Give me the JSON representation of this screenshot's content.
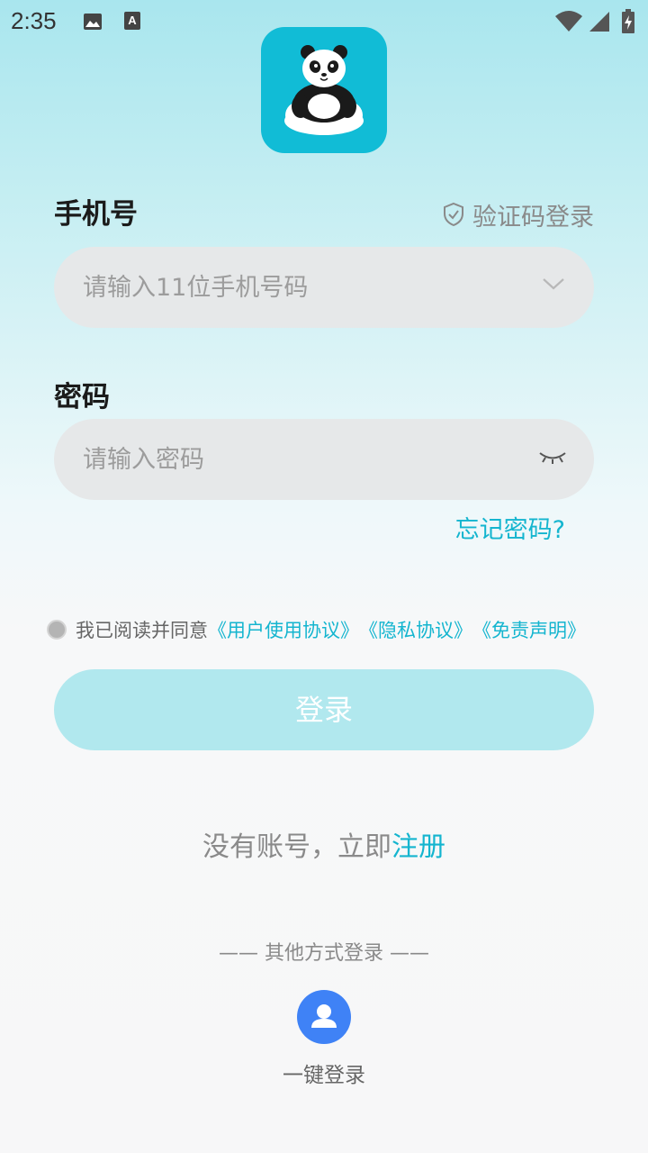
{
  "status_bar": {
    "time": "2:35",
    "icons": [
      "image-icon",
      "keyboard-a-icon",
      "wifi-icon",
      "signal-icon",
      "battery-icon"
    ]
  },
  "logo": {
    "icon": "panda-logo-icon",
    "bg_color": "#11bcd6"
  },
  "phone": {
    "label": "手机号",
    "placeholder": "请输入11位手机号码",
    "value": ""
  },
  "sms_login": {
    "label": "验证码登录",
    "icon": "shield-check-icon"
  },
  "password": {
    "label": "密码",
    "placeholder": "请输入密码",
    "value": ""
  },
  "forgot_password": "忘记密码?",
  "agreement": {
    "prefix": "我已阅读并同意",
    "user_agreement": "《用户使用协议》",
    "privacy": "《隐私协议》",
    "disclaimer": "《免责声明》",
    "checked": false
  },
  "login_button": "登录",
  "register": {
    "prefix": "没有账号，立即",
    "link": "注册"
  },
  "other_methods": {
    "title": "—— 其他方式登录 ——",
    "one_key_label": "一键登录"
  },
  "colors": {
    "accent": "#14b5cf",
    "login_button_disabled": "#b1e8ee",
    "one_key_blue": "#3f82f6"
  }
}
